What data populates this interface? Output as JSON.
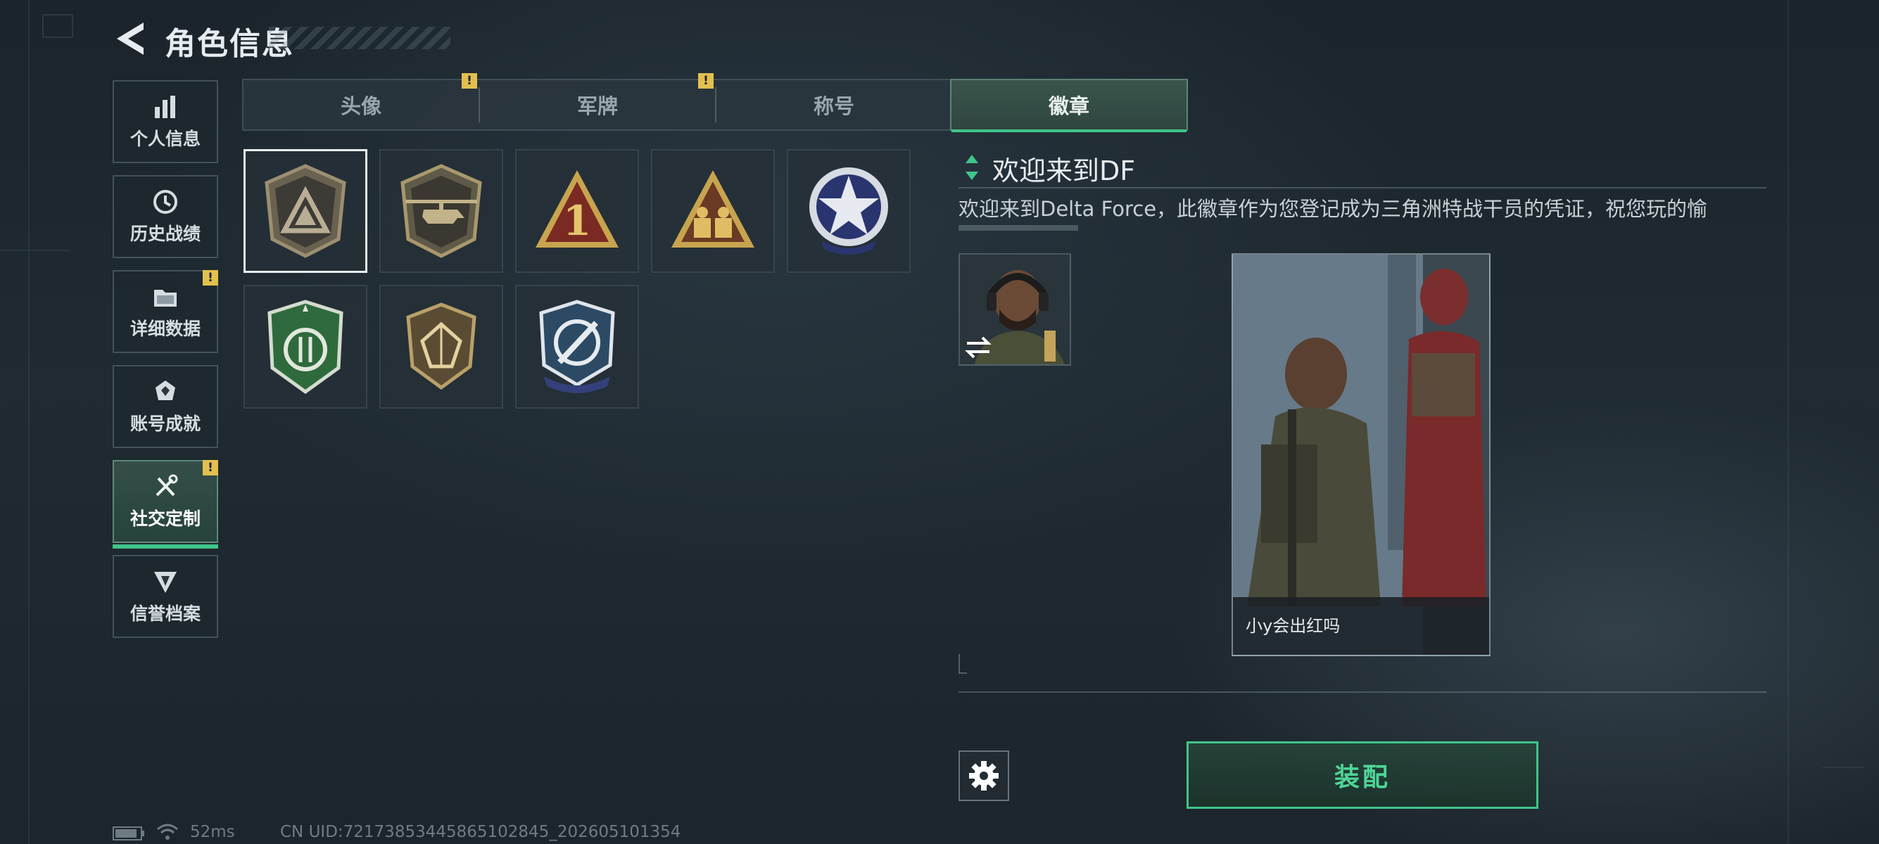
{
  "header": {
    "title": "角色信息"
  },
  "nav": {
    "items": [
      {
        "label": "个人信息",
        "icon": "bar-chart-icon",
        "warning": false
      },
      {
        "label": "历史战绩",
        "icon": "history-clock-icon",
        "warning": false
      },
      {
        "label": "详细数据",
        "icon": "folder-icon",
        "warning": true
      },
      {
        "label": "账号成就",
        "icon": "achievement-icon",
        "warning": false
      },
      {
        "label": "社交定制",
        "icon": "tools-icon",
        "warning": true,
        "active": true
      },
      {
        "label": "信誉档案",
        "icon": "reputation-icon",
        "warning": false
      }
    ]
  },
  "tabs": [
    {
      "label": "头像",
      "warning": true
    },
    {
      "label": "军牌",
      "warning": true
    },
    {
      "label": "称号",
      "warning": false
    },
    {
      "label": "徽章",
      "warning": false,
      "active": true
    }
  ],
  "badges": [
    "delta-shield-badge",
    "helicopter-badge",
    "number-one-triangle-badge",
    "soldiers-triangle-badge",
    "star-seal-badge",
    "green-shield-badge",
    "diamond-shield-badge",
    "crosshair-knife-badge"
  ],
  "detail": {
    "title": "欢迎来到DF",
    "description": "欢迎来到Delta Force，此徽章作为您登记成为三角洲特战干员的凭证，祝您玩的愉"
  },
  "preview": {
    "player_name": "小y会出红吗"
  },
  "equip_button": {
    "label": "装配"
  },
  "status": {
    "ping": "52ms",
    "uid": "CN UID:7217385344586510284​5_202605101354"
  },
  "colors": {
    "accent_green": "#3fc58a",
    "warning_yellow": "#e2c050",
    "background": "#1f2a31"
  }
}
